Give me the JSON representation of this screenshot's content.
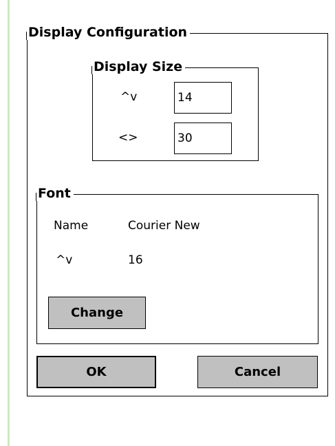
{
  "dialog": {
    "title": "Display Configuration"
  },
  "display_size": {
    "title": "Display Size",
    "rows_label": "^v",
    "rows_value": "14",
    "cols_label": "<>",
    "cols_value": "30"
  },
  "font": {
    "title": "Font",
    "name_label": "Name",
    "name_value": "Courier New",
    "size_label": "^v",
    "size_value": "16",
    "change_label": "Change"
  },
  "buttons": {
    "ok_label": "OK",
    "cancel_label": "Cancel"
  },
  "colors": {
    "background": "#ffffff",
    "button_face": "#c0c0c0",
    "left_rule": "#cfe6c2",
    "border": "#000000"
  }
}
